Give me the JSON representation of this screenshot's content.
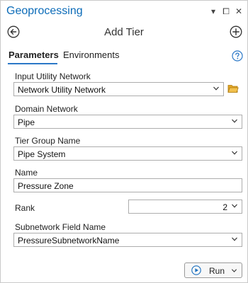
{
  "window": {
    "title": "Geoprocessing",
    "menu_glyph": "▾",
    "pin_glyph": "⧠",
    "close_glyph": "✕"
  },
  "tool": {
    "title": "Add Tier"
  },
  "tabs": [
    {
      "label": "Parameters",
      "active": true
    },
    {
      "label": "Environments",
      "active": false
    }
  ],
  "form": {
    "input_utility_network": {
      "label": "Input Utility Network",
      "value": "Network Utility Network"
    },
    "domain_network": {
      "label": "Domain Network",
      "value": "Pipe"
    },
    "tier_group_name": {
      "label": "Tier Group Name",
      "value": "Pipe System"
    },
    "name": {
      "label": "Name",
      "value": "Pressure Zone"
    },
    "rank": {
      "label": "Rank",
      "value": "2"
    },
    "subnetwork_field_name": {
      "label": "Subnetwork Field Name",
      "value": "PressureSubnetworkName"
    }
  },
  "run_button": {
    "label": "Run"
  },
  "colors": {
    "accent": "#0b6bb8",
    "tab_underline": "#2b78c7",
    "folder": "#e0a526",
    "run_play": "#1a6fc0"
  }
}
